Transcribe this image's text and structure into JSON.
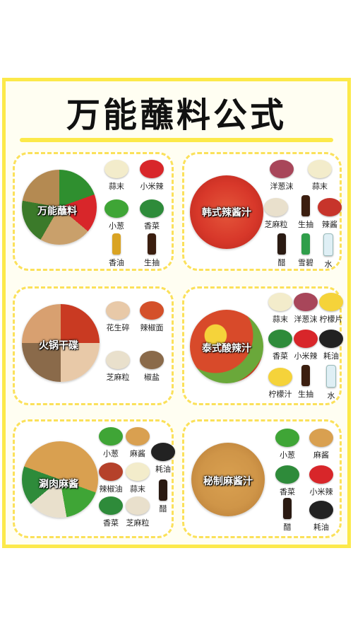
{
  "title": "万能蘸料公式",
  "cards": [
    {
      "dish": "万能蘸料",
      "ingredients": [
        "蒜末",
        "小米辣",
        "小葱",
        "香菜",
        "香油",
        "生抽"
      ]
    },
    {
      "dish": "韩式辣酱汁",
      "ingredients": [
        "洋葱沫",
        "蒜末",
        "芝麻粒",
        "生抽",
        "辣酱",
        "醋",
        "雪碧",
        "水"
      ]
    },
    {
      "dish": "火锅干碟",
      "ingredients": [
        "花生碎",
        "辣椒面",
        "芝麻粒",
        "椒盐"
      ]
    },
    {
      "dish": "泰式酸辣汁",
      "ingredients": [
        "蒜末",
        "洋葱沫",
        "柠檬片",
        "香菜",
        "小米辣",
        "耗油",
        "柠檬汁",
        "生抽",
        "水"
      ]
    },
    {
      "dish": "涮肉麻酱",
      "ingredients": [
        "小葱",
        "麻酱",
        "耗油",
        "辣椒油",
        "蒜末",
        "醋",
        "香菜",
        "芝麻粒"
      ]
    },
    {
      "dish": "秘制麻酱汁",
      "ingredients": [
        "小葱",
        "麻酱",
        "香菜",
        "小米辣",
        "醋",
        "耗油"
      ]
    }
  ],
  "colors": {
    "frame": "#fce94a",
    "dash": "#fbe15a",
    "garlic": "#f3eccb",
    "chili": "#d8262a",
    "scallion": "#3fa536",
    "cilantro": "#2e8b3a",
    "sesame_oil": "#d9a323",
    "soy": "#3b1e0f",
    "onion": "#a8465a",
    "sesame": "#e9e0cc",
    "chili_paste": "#c7342b",
    "vinegar": "#2a1a12",
    "sprite": "#2f9e4a",
    "water": "#dfeff5",
    "peanut": "#e8c9a8",
    "chili_powder": "#d4502a",
    "pepper_salt": "#8a6a4a",
    "lemon": "#f5d33a",
    "oyster": "#222222",
    "tahini": "#d9a050",
    "chili_oil": "#b5412a"
  }
}
